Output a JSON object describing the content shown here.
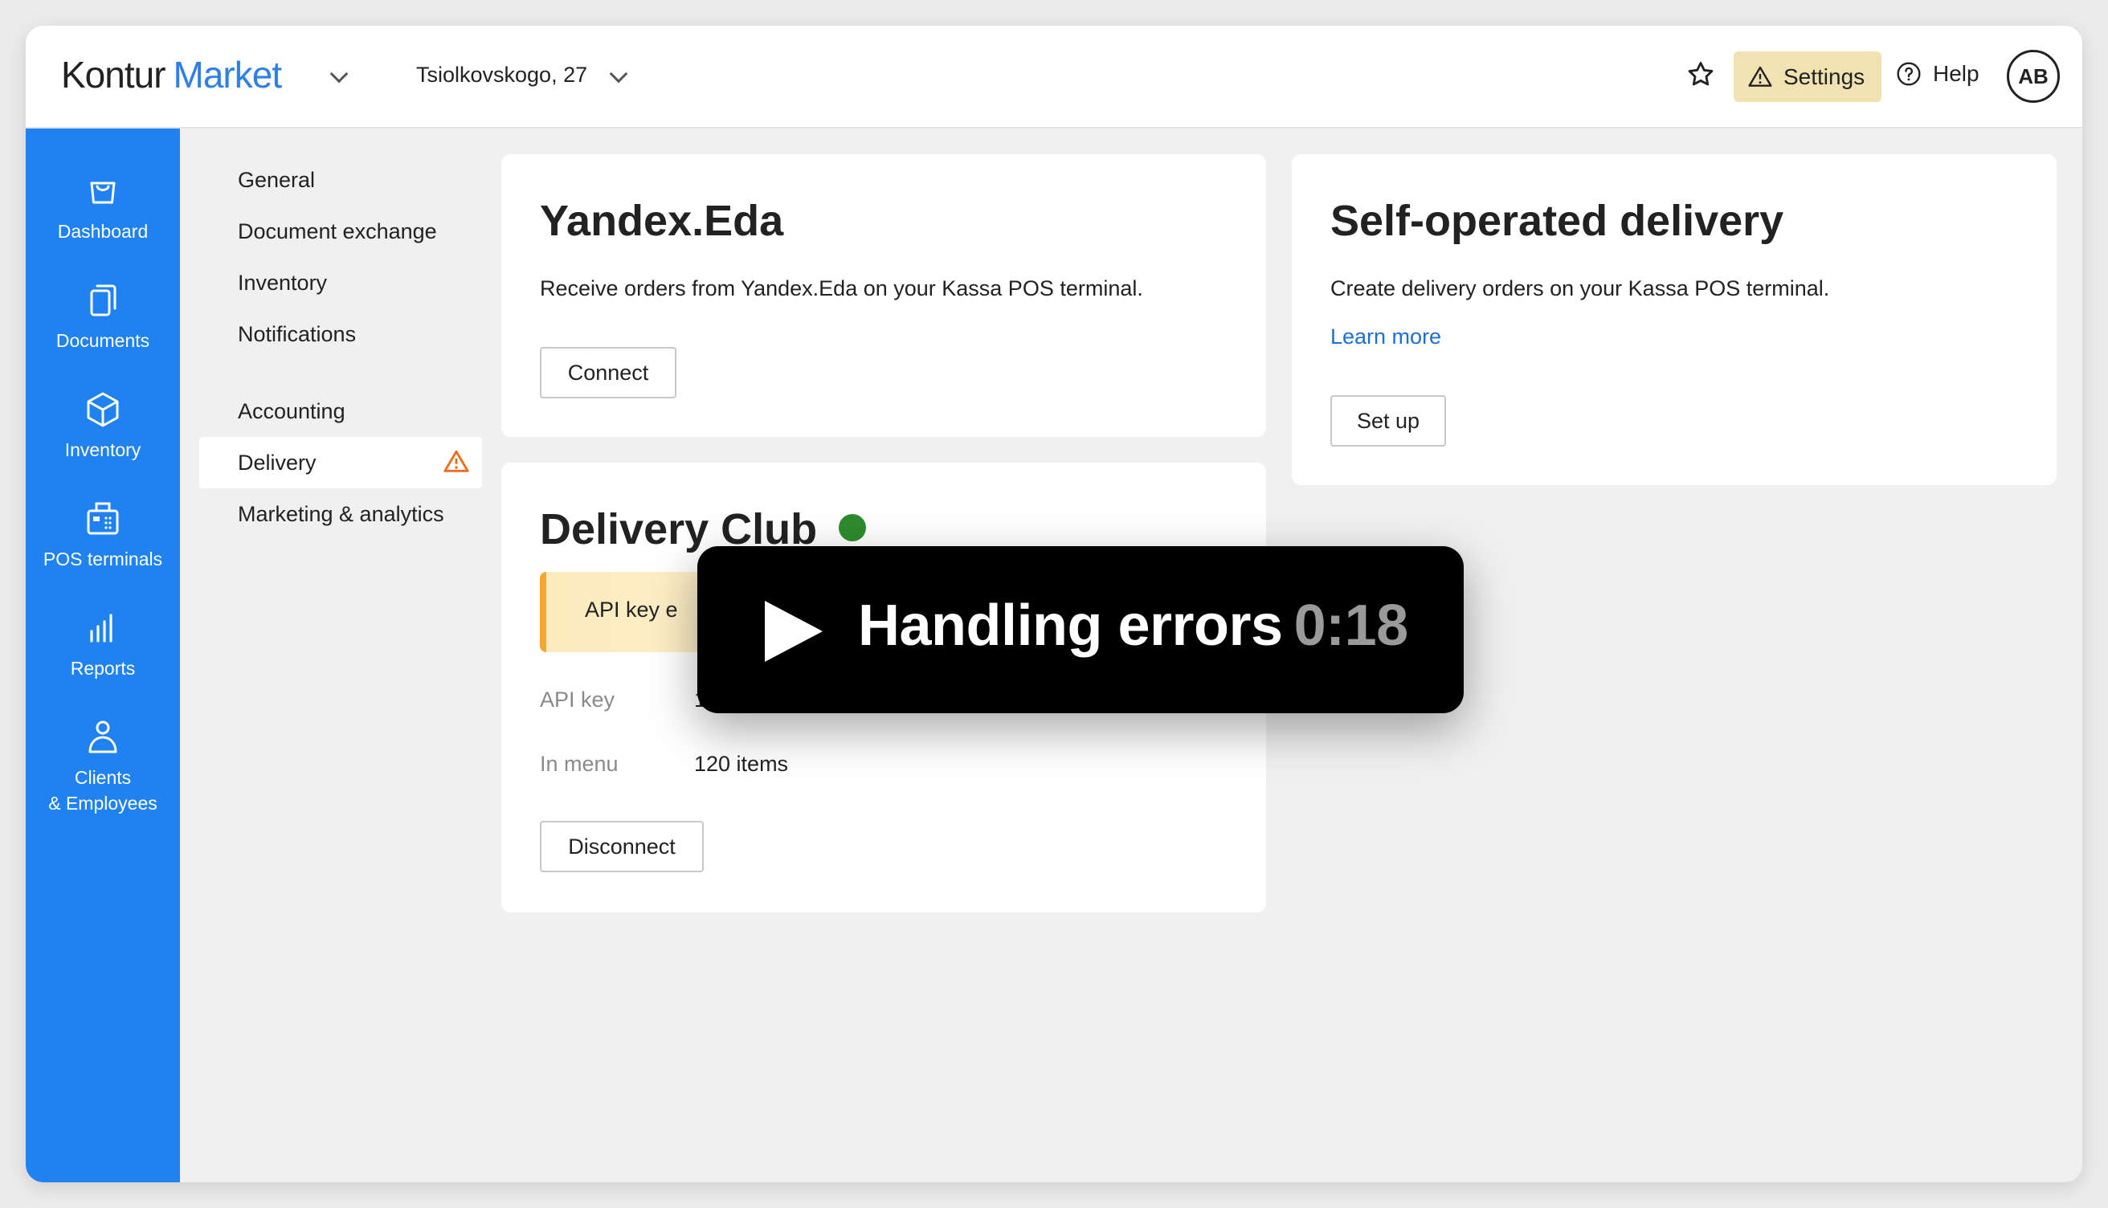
{
  "header": {
    "logo_primary": "Kontur",
    "logo_secondary": "Market",
    "store": "Tsiolkovskogo, 27",
    "settings_label": "Settings",
    "help_label": "Help",
    "avatar_initials": "AB"
  },
  "nav": {
    "items": [
      {
        "label": "Dashboard",
        "icon": "bag-icon"
      },
      {
        "label": "Documents",
        "icon": "documents-icon"
      },
      {
        "label": "Inventory",
        "icon": "box-icon"
      },
      {
        "label": "POS terminals",
        "icon": "pos-terminal-icon"
      },
      {
        "label": "Reports",
        "icon": "bar-chart-icon"
      },
      {
        "label": "Clients",
        "label2": "& Employees",
        "icon": "person-icon"
      }
    ]
  },
  "submenu": {
    "items": [
      "General",
      "Document exchange",
      "Inventory",
      "Notifications",
      "Accounting",
      "Delivery",
      "Marketing & analytics"
    ],
    "active": "Delivery"
  },
  "yandex": {
    "title": "Yandex.Eda",
    "description": "Receive orders from Yandex.Eda on your Kassa POS terminal.",
    "button": "Connect"
  },
  "self_delivery": {
    "title": "Self-operated delivery",
    "description": "Create delivery orders on your Kassa POS terminal.",
    "link": "Learn more",
    "button": "Set up"
  },
  "delivery_club": {
    "title": "Delivery Club",
    "banner": "API key e",
    "api_key_label": "API key",
    "api_key_value": "123waeg-q2323",
    "menu_label": "In menu",
    "menu_value": "120 items",
    "button": "Disconnect"
  },
  "video": {
    "title": "Handling errors",
    "time": "0:18"
  },
  "colors": {
    "accent": "#2082f0",
    "warning_bg": "#f1e2b2",
    "link": "#1c6fd6",
    "success": "#2e8b2e"
  }
}
